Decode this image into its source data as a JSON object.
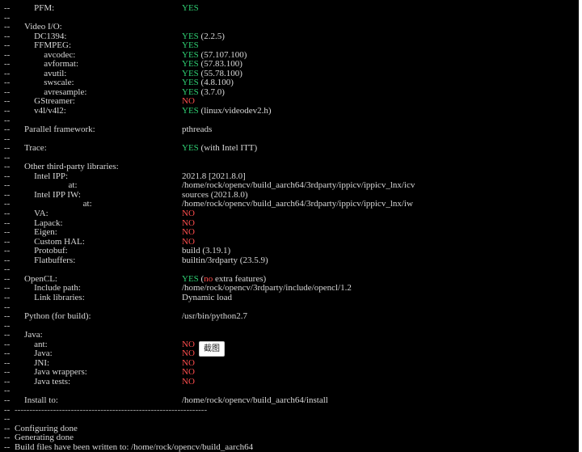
{
  "terminal": {
    "prefix": "--",
    "lines": [
      {
        "label": "PFM:",
        "indent": 3,
        "status": "YES",
        "rest": ""
      },
      {
        "label": "",
        "indent": 0,
        "status": "",
        "rest": ""
      },
      {
        "label": "Video I/O:",
        "indent": 1,
        "status": "",
        "rest": ""
      },
      {
        "label": "DC1394:",
        "indent": 3,
        "status": "YES",
        "rest": " (2.2.5)"
      },
      {
        "label": "FFMPEG:",
        "indent": 3,
        "status": "YES",
        "rest": ""
      },
      {
        "label": "avcodec:",
        "indent": 5,
        "status": "YES",
        "rest": " (57.107.100)"
      },
      {
        "label": "avformat:",
        "indent": 5,
        "status": "YES",
        "rest": " (57.83.100)"
      },
      {
        "label": "avutil:",
        "indent": 5,
        "status": "YES",
        "rest": " (55.78.100)"
      },
      {
        "label": "swscale:",
        "indent": 5,
        "status": "YES",
        "rest": " (4.8.100)"
      },
      {
        "label": "avresample:",
        "indent": 5,
        "status": "YES",
        "rest": " (3.7.0)"
      },
      {
        "label": "GStreamer:",
        "indent": 3,
        "status": "NO",
        "rest": ""
      },
      {
        "label": "v4l/v4l2:",
        "indent": 3,
        "status": "YES",
        "rest": " (linux/videodev2.h)"
      },
      {
        "label": "",
        "indent": 0,
        "status": "",
        "rest": ""
      },
      {
        "label": "Parallel framework:",
        "indent": 1,
        "status": "",
        "rest": "pthreads"
      },
      {
        "label": "",
        "indent": 0,
        "status": "",
        "rest": ""
      },
      {
        "label": "Trace:",
        "indent": 1,
        "status": "YES",
        "rest": " (with Intel ITT)"
      },
      {
        "label": "",
        "indent": 0,
        "status": "",
        "rest": ""
      },
      {
        "label": "Other third-party libraries:",
        "indent": 1,
        "status": "",
        "rest": ""
      },
      {
        "label": "Intel IPP:",
        "indent": 3,
        "status": "",
        "rest": "2021.8 [2021.8.0]"
      },
      {
        "label": "at:",
        "indent": 10,
        "status": "",
        "rest": "/home/rock/opencv/build_aarch64/3rdparty/ippicv/ippicv_lnx/icv"
      },
      {
        "label": "Intel IPP IW:",
        "indent": 3,
        "status": "",
        "rest": "sources (2021.8.0)"
      },
      {
        "label": "at:",
        "indent": 13,
        "status": "",
        "rest": "/home/rock/opencv/build_aarch64/3rdparty/ippicv/ippicv_lnx/iw"
      },
      {
        "label": "VA:",
        "indent": 3,
        "status": "NO",
        "rest": ""
      },
      {
        "label": "Lapack:",
        "indent": 3,
        "status": "NO",
        "rest": ""
      },
      {
        "label": "Eigen:",
        "indent": 3,
        "status": "NO",
        "rest": ""
      },
      {
        "label": "Custom HAL:",
        "indent": 3,
        "status": "NO",
        "rest": ""
      },
      {
        "label": "Protobuf:",
        "indent": 3,
        "status": "",
        "rest": "build (3.19.1)"
      },
      {
        "label": "Flatbuffers:",
        "indent": 3,
        "status": "",
        "rest": "builtin/3rdparty (23.5.9)"
      },
      {
        "label": "",
        "indent": 0,
        "status": "",
        "rest": ""
      },
      {
        "label": "OpenCL:",
        "indent": 1,
        "status": "YES",
        "rest": " (",
        "inline_no": "no",
        "rest2": " extra features)"
      },
      {
        "label": "Include path:",
        "indent": 3,
        "status": "",
        "rest": "/home/rock/opencv/3rdparty/include/opencl/1.2"
      },
      {
        "label": "Link libraries:",
        "indent": 3,
        "status": "",
        "rest": "Dynamic load"
      },
      {
        "label": "",
        "indent": 0,
        "status": "",
        "rest": ""
      },
      {
        "label": "Python (for build):",
        "indent": 1,
        "status": "",
        "rest": "/usr/bin/python2.7"
      },
      {
        "label": "",
        "indent": 0,
        "status": "",
        "rest": ""
      },
      {
        "label": "Java:",
        "indent": 1,
        "status": "",
        "rest": ""
      },
      {
        "label": "ant:",
        "indent": 3,
        "status": "NO",
        "rest": ""
      },
      {
        "label": "Java:",
        "indent": 3,
        "status": "NO",
        "rest": ""
      },
      {
        "label": "JNI:",
        "indent": 3,
        "status": "NO",
        "rest": ""
      },
      {
        "label": "Java wrappers:",
        "indent": 3,
        "status": "NO",
        "rest": ""
      },
      {
        "label": "Java tests:",
        "indent": 3,
        "status": "NO",
        "rest": ""
      },
      {
        "label": "",
        "indent": 0,
        "status": "",
        "rest": ""
      },
      {
        "label": "Install to:",
        "indent": 1,
        "status": "",
        "rest": "/home/rock/opencv/build_aarch64/install"
      }
    ],
    "separator": "-----------------------------------------------------------------",
    "footer": [
      "",
      "Configuring done",
      "Generating done",
      "Build files have been written to: /home/rock/opencv/build_aarch64"
    ]
  },
  "tooltip": {
    "label": "截图"
  },
  "colors": {
    "background": "#000000",
    "yes": "#2ecc71",
    "no": "#ff4d4d",
    "text": "#d8d8d8"
  }
}
